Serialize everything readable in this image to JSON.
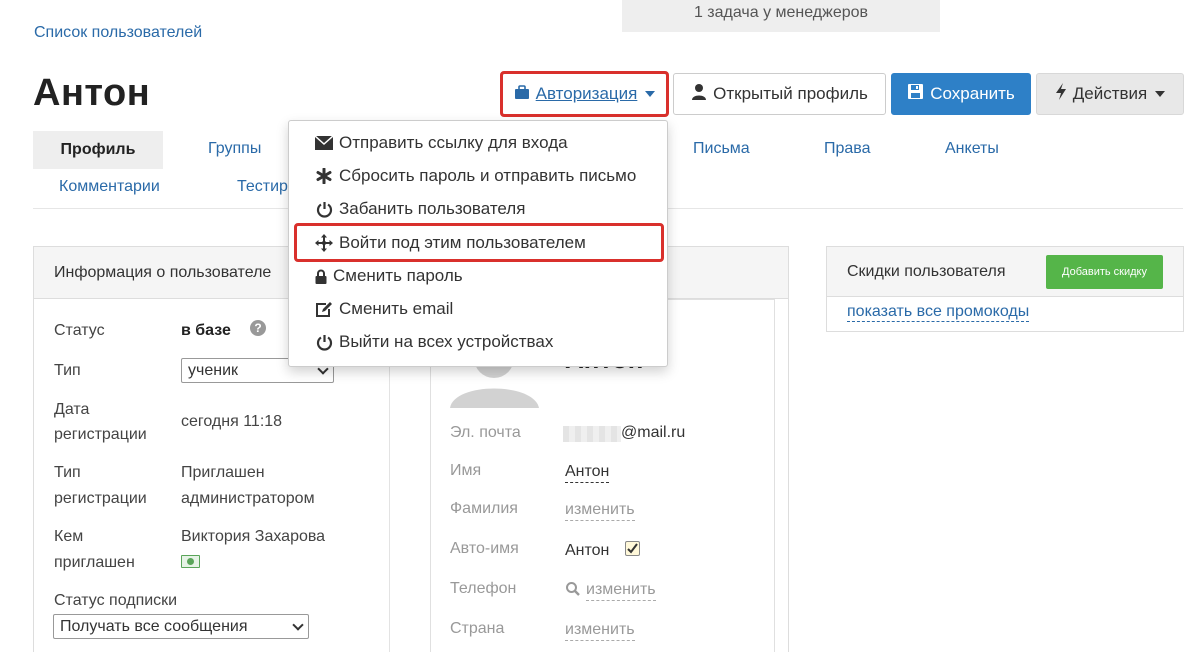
{
  "notice": "1 задача у менеджеров",
  "breadcrumb": "Список пользователей",
  "page_title": "Антон",
  "toolbar": {
    "auth_label": "Авторизация",
    "profile_label": "Открытый профиль",
    "save_label": "Сохранить",
    "actions_label": "Действия"
  },
  "tabs": {
    "profile": "Профиль",
    "groups": "Группы",
    "letters": "Письма",
    "rights": "Права",
    "forms": "Анкеты",
    "comments": "Комментарии",
    "tests": "Тестир"
  },
  "auth_menu": [
    {
      "label": "Отправить ссылку для входа",
      "icon": "envelope-icon"
    },
    {
      "label": "Сбросить пароль и отправить письмо",
      "icon": "asterisk-icon"
    },
    {
      "label": "Забанить пользователя",
      "icon": "power-icon"
    },
    {
      "label": "Войти под этим пользователем",
      "icon": "move-icon"
    },
    {
      "label": "Сменить пароль",
      "icon": "lock-icon"
    },
    {
      "label": "Сменить email",
      "icon": "edit-icon"
    },
    {
      "label": "Выйти на всех устройствах",
      "icon": "power-icon"
    }
  ],
  "info_panel": {
    "title": "Информация о пользователе",
    "status_label": "Статус",
    "status_value": "в базе",
    "type_label": "Тип",
    "type_value": "ученик",
    "reg_date_label_1": "Дата",
    "reg_date_label_2": "регистрации",
    "reg_date_value": "сегодня 11:18",
    "reg_type_label_1": "Тип",
    "reg_type_label_2": "регистрации",
    "reg_type_value_1": "Приглашен",
    "reg_type_value_2": "администратором",
    "invited_label_1": "Кем",
    "invited_label_2": "приглашен",
    "invited_value": "Виктория Захарова",
    "subscription_label": "Статус подписки",
    "subscription_value": "Получать все сообщения"
  },
  "profile_card": {
    "name": "Антон",
    "email_label": "Эл. почта",
    "email_value": "@mail.ru",
    "first_name_label": "Имя",
    "first_name_value": "Антон",
    "last_name_label": "Фамилия",
    "last_name_value": "изменить",
    "auto_name_label": "Авто-имя",
    "auto_name_value": "Антон",
    "phone_label": "Телефон",
    "phone_value": "изменить",
    "country_label": "Страна",
    "country_value": "изменить"
  },
  "discounts": {
    "title": "Скидки пользователя",
    "add_label": "Добавить скидку",
    "show_all": "показать все промокоды"
  },
  "colors": {
    "accent": "#2e80c7",
    "link": "#2a6aa8",
    "highlight": "#d9302c",
    "green": "#55b549"
  }
}
